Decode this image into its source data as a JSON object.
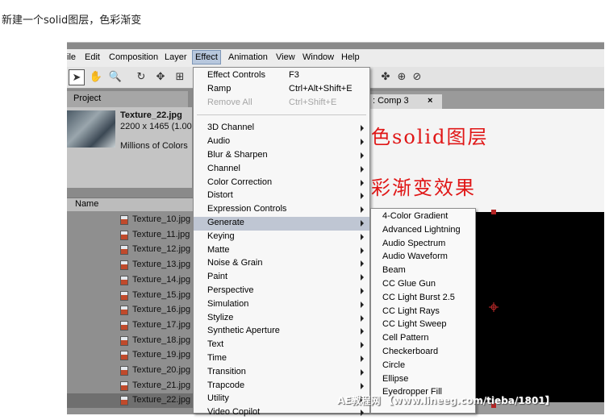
{
  "caption": "新建一个solid图层，色彩渐变",
  "menubar": {
    "items": [
      "ile",
      "Edit",
      "Composition",
      "Layer",
      "Effect",
      "Animation",
      "View",
      "Window",
      "Help"
    ],
    "active": "Effect"
  },
  "project": {
    "tab_label": "Project",
    "file_name": "Texture_22.jpg",
    "dimensions": "2200 x 1465 (1.00",
    "colors": "Millions of Colors",
    "column_name": "Name",
    "files": [
      "Texture_10.jpg",
      "Texture_11.jpg",
      "Texture_12.jpg",
      "Texture_13.jpg",
      "Texture_14.jpg",
      "Texture_15.jpg",
      "Texture_16.jpg",
      "Texture_17.jpg",
      "Texture_18.jpg",
      "Texture_19.jpg",
      "Texture_20.jpg",
      "Texture_21.jpg",
      "Texture_22.jpg"
    ],
    "selected_file": "Texture_22.jpg"
  },
  "comp": {
    "tab_label": ": Comp 3",
    "close_glyph": "×"
  },
  "annotations": {
    "line1": "新建黑色solid图层",
    "line2": "添加色彩渐变效果",
    "color": "#e01616"
  },
  "effect_menu": {
    "items": [
      {
        "label": "Effect Controls",
        "shortcut": "F3"
      },
      {
        "label": "Ramp",
        "shortcut": "Ctrl+Alt+Shift+E"
      },
      {
        "label": "Remove All",
        "shortcut": "Ctrl+Shift+E",
        "disabled": true
      },
      {
        "label": "3D Channel",
        "submenu": true
      },
      {
        "label": "Audio",
        "submenu": true
      },
      {
        "label": "Blur & Sharpen",
        "submenu": true
      },
      {
        "label": "Channel",
        "submenu": true
      },
      {
        "label": "Color Correction",
        "submenu": true
      },
      {
        "label": "Distort",
        "submenu": true
      },
      {
        "label": "Expression Controls",
        "submenu": true
      },
      {
        "label": "Generate",
        "submenu": true,
        "highlighted": true
      },
      {
        "label": "Keying",
        "submenu": true
      },
      {
        "label": "Matte",
        "submenu": true
      },
      {
        "label": "Noise & Grain",
        "submenu": true
      },
      {
        "label": "Paint",
        "submenu": true
      },
      {
        "label": "Perspective",
        "submenu": true
      },
      {
        "label": "Simulation",
        "submenu": true
      },
      {
        "label": "Stylize",
        "submenu": true
      },
      {
        "label": "Synthetic Aperture",
        "submenu": true
      },
      {
        "label": "Text",
        "submenu": true
      },
      {
        "label": "Time",
        "submenu": true
      },
      {
        "label": "Transition",
        "submenu": true
      },
      {
        "label": "Trapcode",
        "submenu": true
      },
      {
        "label": "Utility",
        "submenu": true
      },
      {
        "label": "Video Copilot",
        "submenu": true
      }
    ]
  },
  "generate_submenu": {
    "items": [
      "4-Color Gradient",
      "Advanced Lightning",
      "Audio Spectrum",
      "Audio Waveform",
      "Beam",
      "CC Glue Gun",
      "CC Light Burst 2.5",
      "CC Light Rays",
      "CC Light Sweep",
      "Cell Pattern",
      "Checkerboard",
      "Circle",
      "Ellipse",
      "Eyedropper Fill"
    ]
  },
  "watermark": "AE教程网  【www.lineeg.com/tieba/1801】"
}
